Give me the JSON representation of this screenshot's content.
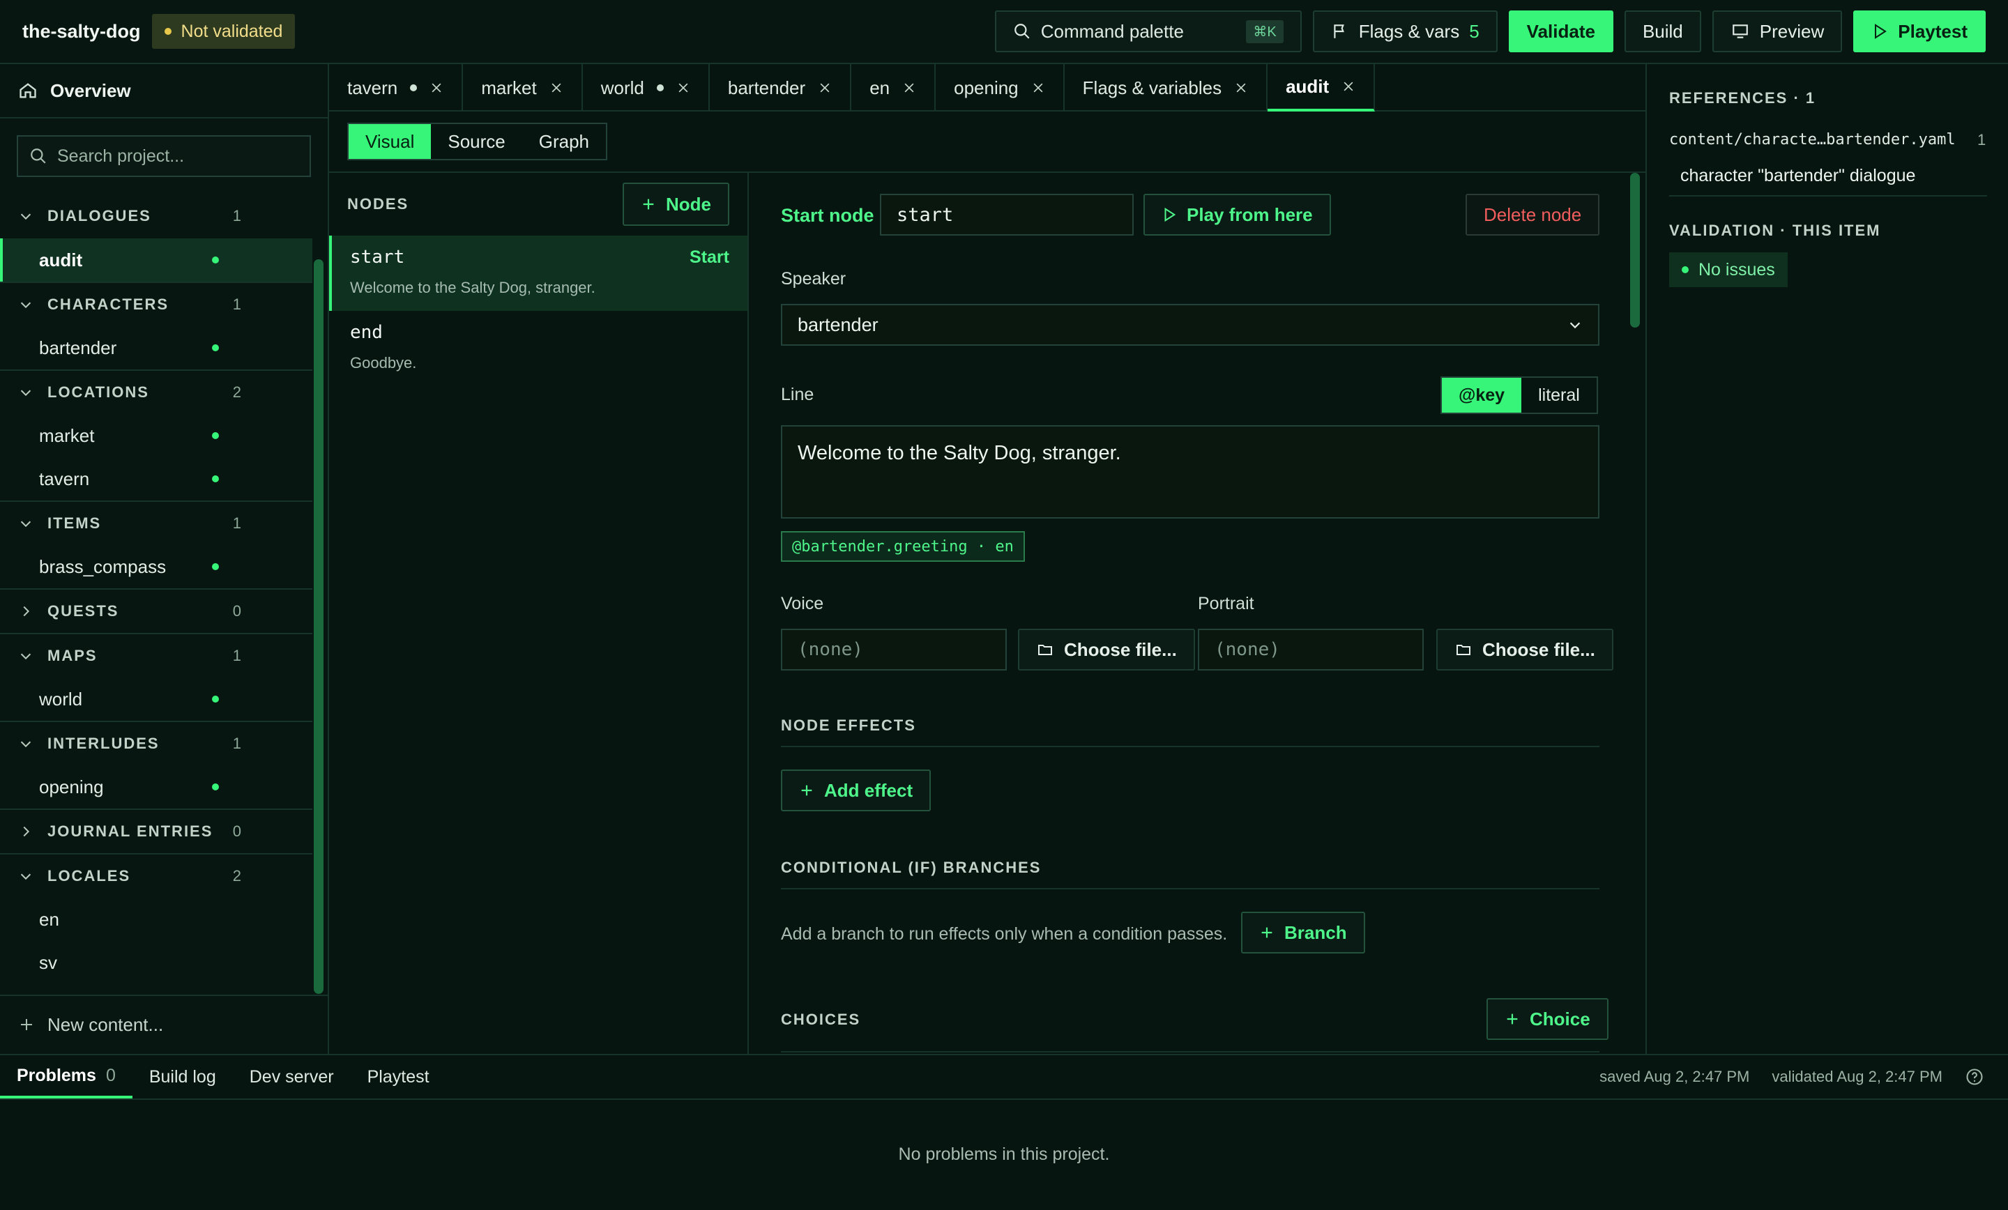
{
  "topbar": {
    "project_name": "the-salty-dog",
    "validation_status": "Not validated",
    "command_palette_label": "Command palette",
    "command_palette_shortcut": "⌘K",
    "flags_label": "Flags & vars",
    "flags_count": "5",
    "validate_label": "Validate",
    "build_label": "Build",
    "preview_label": "Preview",
    "playtest_label": "Playtest"
  },
  "sidebar": {
    "overview_label": "Overview",
    "search_placeholder": "Search project...",
    "sections": [
      {
        "label": "DIALOGUES",
        "count": "1",
        "expanded": true,
        "items": [
          "audit"
        ]
      },
      {
        "label": "CHARACTERS",
        "count": "1",
        "expanded": true,
        "items": [
          "bartender"
        ]
      },
      {
        "label": "LOCATIONS",
        "count": "2",
        "expanded": true,
        "items": [
          "market",
          "tavern"
        ]
      },
      {
        "label": "ITEMS",
        "count": "1",
        "expanded": true,
        "items": [
          "brass_compass"
        ]
      },
      {
        "label": "QUESTS",
        "count": "0",
        "expanded": false,
        "items": []
      },
      {
        "label": "MAPS",
        "count": "1",
        "expanded": true,
        "items": [
          "world"
        ]
      },
      {
        "label": "INTERLUDES",
        "count": "1",
        "expanded": true,
        "items": [
          "opening"
        ]
      },
      {
        "label": "JOURNAL ENTRIES",
        "count": "0",
        "expanded": false,
        "items": []
      },
      {
        "label": "LOCALES",
        "count": "2",
        "expanded": true,
        "items": [
          "en",
          "sv"
        ]
      }
    ],
    "new_content_label": "New content..."
  },
  "tabs": [
    {
      "label": "tavern",
      "modified": true
    },
    {
      "label": "market",
      "modified": false
    },
    {
      "label": "world",
      "modified": true
    },
    {
      "label": "bartender",
      "modified": false
    },
    {
      "label": "en",
      "modified": false
    },
    {
      "label": "opening",
      "modified": false
    },
    {
      "label": "Flags & variables",
      "modified": false
    },
    {
      "label": "audit",
      "modified": false,
      "active": true
    }
  ],
  "view_switch": {
    "visual": "Visual",
    "source": "Source",
    "graph": "Graph"
  },
  "nodes_panel": {
    "title": "NODES",
    "add_node_label": "Node",
    "nodes": [
      {
        "id": "start",
        "tag": "Start",
        "preview": "Welcome to the Salty Dog, stranger."
      },
      {
        "id": "end",
        "tag": "",
        "preview": "Goodbye."
      }
    ]
  },
  "node_detail": {
    "start_node_label": "Start node",
    "start_node_value": "start",
    "play_from_here_label": "Play from here",
    "delete_node_label": "Delete node",
    "speaker_label": "Speaker",
    "speaker_value": "bartender",
    "line_label": "Line",
    "line_mode_key": "@key",
    "line_mode_literal": "literal",
    "line_text": "Welcome to the Salty Dog, stranger.",
    "line_key_chip": "@bartender.greeting · en",
    "voice_label": "Voice",
    "voice_placeholder": "(none)",
    "portrait_label": "Portrait",
    "portrait_placeholder": "(none)",
    "choose_file_label": "Choose file...",
    "node_effects_title": "NODE EFFECTS",
    "add_effect_label": "Add effect",
    "conditional_title": "CONDITIONAL (IF) BRANCHES",
    "conditional_hint": "Add a branch to run effects only when a condition passes.",
    "branch_label": "Branch",
    "choices_title": "CHOICES",
    "choice_label": "Choice"
  },
  "right_panel": {
    "references_title": "REFERENCES · 1",
    "reference_path": "content/characte…bartender.yaml",
    "reference_count": "1",
    "reference_desc": "character \"bartender\" dialogue",
    "validation_title": "VALIDATION · THIS ITEM",
    "validation_result": "No issues"
  },
  "bottom_panel": {
    "tabs": [
      {
        "label": "Problems",
        "count": "0",
        "active": true
      },
      {
        "label": "Build log",
        "count": ""
      },
      {
        "label": "Dev server",
        "count": ""
      },
      {
        "label": "Playtest",
        "count": ""
      }
    ],
    "saved_status": "saved Aug 2, 2:47 PM",
    "validated_status": "validated Aug 2, 2:47 PM",
    "empty_message": "No problems in this project."
  }
}
